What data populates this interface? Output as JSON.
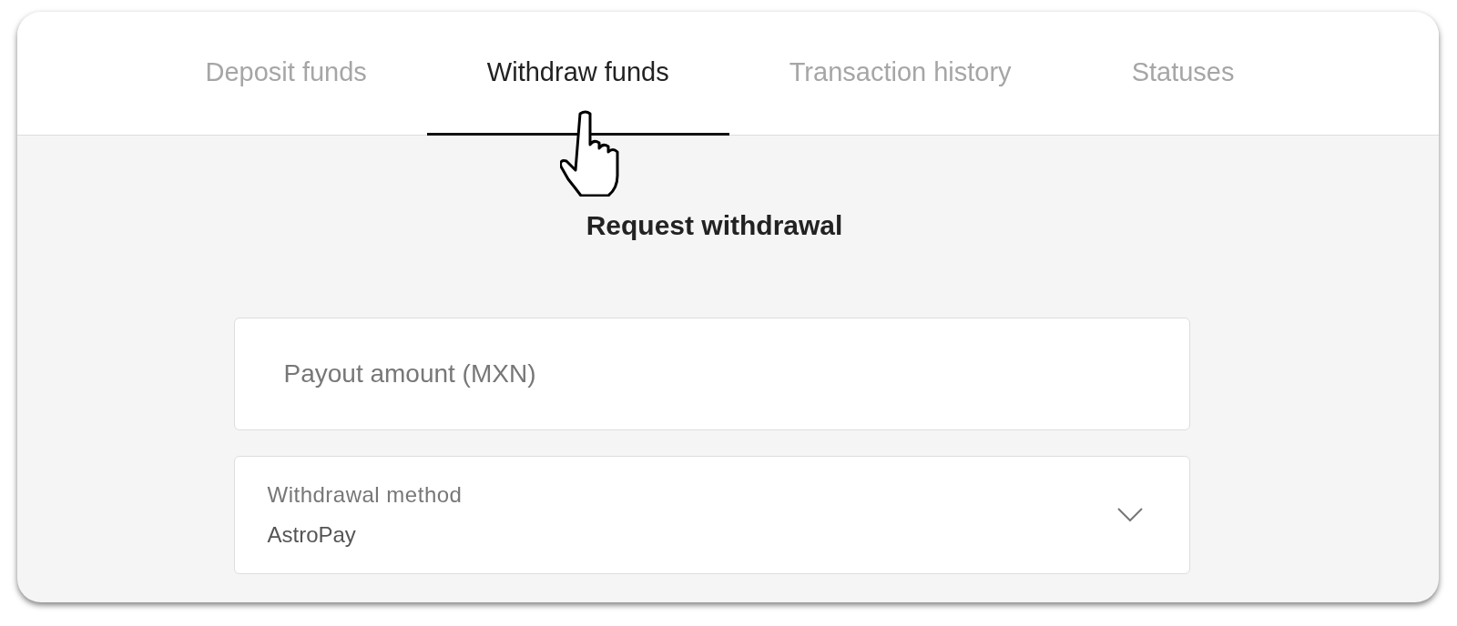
{
  "tabs": [
    {
      "label": "Deposit funds",
      "selected": false
    },
    {
      "label": "Withdraw funds",
      "selected": true
    },
    {
      "label": "Transaction history",
      "selected": false
    },
    {
      "label": "Statuses",
      "selected": false
    }
  ],
  "heading": "Request withdrawal",
  "payout_amount": {
    "placeholder": "Payout amount (MXN)"
  },
  "withdrawal_method": {
    "label": "Withdrawal method",
    "value": "AstroPay"
  }
}
